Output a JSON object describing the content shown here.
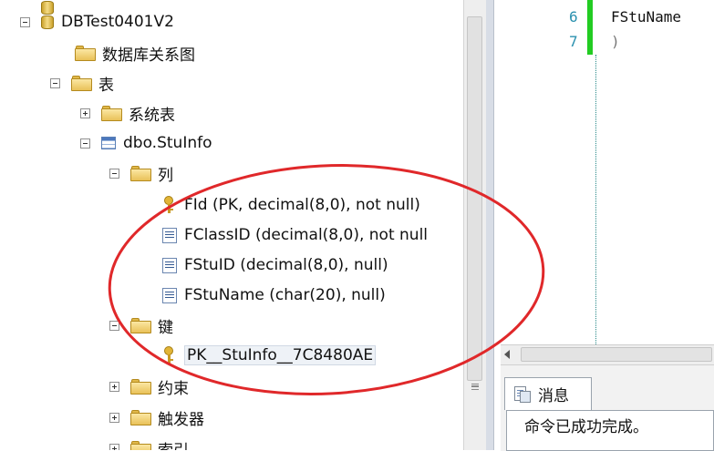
{
  "object_explorer": {
    "database": "DBTest0401V2",
    "diagrams_folder": "数据库关系图",
    "tables_folder": "表",
    "system_tables_folder": "系统表",
    "table_name": "dbo.StuInfo",
    "columns_folder": "列",
    "columns": [
      {
        "label": "FId (PK, decimal(8,0), not null)",
        "icon": "primary-key-icon"
      },
      {
        "label": "FClassID (decimal(8,0), not null",
        "icon": "column-icon"
      },
      {
        "label": "FStuID (decimal(8,0), null)",
        "icon": "column-icon"
      },
      {
        "label": "FStuName (char(20), null)",
        "icon": "column-icon"
      }
    ],
    "keys_folder": "键",
    "key_name": "PK__StuInfo__7C8480AE",
    "constraints_folder": "约束",
    "triggers_folder": "触发器",
    "indexes_folder": "索引"
  },
  "editor": {
    "lines": [
      {
        "number": "6",
        "code": "FStuName"
      },
      {
        "number": "7",
        "code": ")"
      }
    ]
  },
  "results": {
    "tab_label": "消息",
    "message": "命令已成功完成。"
  },
  "colors": {
    "annotation_oval": "#e0282a",
    "change_bar": "#22cc22",
    "line_number": "#2b91af"
  }
}
